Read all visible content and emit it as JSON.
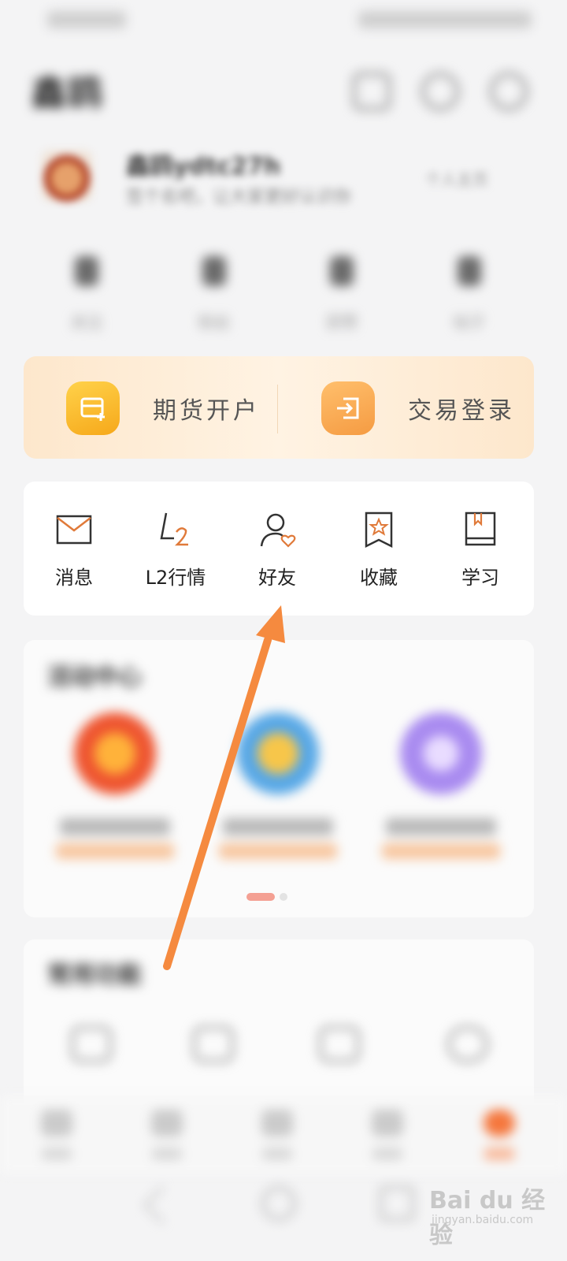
{
  "header": {
    "title": "鑫鸥"
  },
  "profile": {
    "username": "鑫鸥ydtc27h",
    "subtitle": "签个名吧，让大家更好认识你",
    "link": "个人主页"
  },
  "stats": [
    {
      "label": "关注"
    },
    {
      "label": "粉丝"
    },
    {
      "label": "获赞"
    },
    {
      "label": "帖子"
    }
  ],
  "account_card": {
    "open_account_label": "期货开户",
    "trade_login_label": "交易登录",
    "colors": {
      "yellow": "#F6A81A",
      "orange": "#F59B42"
    }
  },
  "quick_menu": {
    "items": [
      {
        "label": "消息",
        "icon": "mail-icon"
      },
      {
        "label": "L2行情",
        "icon": "l2-icon"
      },
      {
        "label": "好友",
        "icon": "user-heart-icon"
      },
      {
        "label": "收藏",
        "icon": "bookmark-star-icon"
      },
      {
        "label": "学习",
        "icon": "book-icon"
      }
    ]
  },
  "activity": {
    "title": "活动中心",
    "items": [
      {
        "icon": "red-coin-icon"
      },
      {
        "icon": "blue-coin-icon"
      },
      {
        "icon": "purple-badge-icon"
      }
    ]
  },
  "features": {
    "title": "常用功能"
  },
  "bottom_nav": {
    "active_index": 4,
    "accent": "#F5773D"
  },
  "watermark": {
    "text": "Bai du 经验",
    "sub": "jingyan.baidu.com"
  },
  "annotation": {
    "color": "#F58A3F"
  }
}
